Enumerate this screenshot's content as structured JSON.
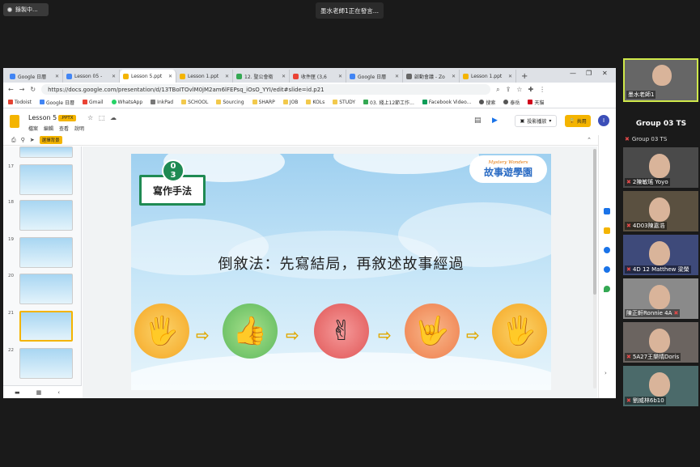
{
  "meeting": {
    "recording_label": "錄製中...",
    "speaker_banner": "墨水老師1正在發言..."
  },
  "browser": {
    "tabs": [
      {
        "label": "Google 日曆",
        "color": "#4285f4"
      },
      {
        "label": "Lesson 05 - ",
        "color": "#4285f4"
      },
      {
        "label": "Lesson 5.ppt",
        "color": "#f4b400",
        "active": true
      },
      {
        "label": "Lesson 1.ppt",
        "color": "#f4b400"
      },
      {
        "label": "12. 聖公會衛",
        "color": "#34a853"
      },
      {
        "label": "收件匣 (3,6",
        "color": "#ea4335"
      },
      {
        "label": "Google 日曆",
        "color": "#4285f4"
      },
      {
        "label": "啟動會議 - Zo",
        "color": "#666666"
      },
      {
        "label": "Lesson 1.ppt",
        "color": "#f4b400"
      }
    ],
    "new_tab": "+",
    "url": "https://docs.google.com/presentation/d/13TBoITOvlM0jM2am6lFEPsq_iOsO_YYI/edit#slide=id.p21",
    "bookmarks": [
      "Todoist",
      "Google 日曆",
      "Gmail",
      "WhatsApp",
      "InkPad",
      "SCHOOL",
      "Sourcing",
      "SHARP",
      "JOB",
      "KOLs",
      "STUDY",
      "03. 綫上12節工作...",
      "Facebook Video...",
      "搜索",
      "泰岳",
      "天貓"
    ]
  },
  "slides_app": {
    "doc_title": "Lesson 5",
    "file_badge": ".PPTX",
    "menu": [
      "檔案",
      "編輯",
      "查看",
      "說明"
    ],
    "slideshow_label": "投影播放",
    "share_label": "共用",
    "user_initial": "I",
    "background_option": "選擇背景",
    "thumb_numbers": [
      "17",
      "18",
      "19",
      "20",
      "21",
      "22"
    ]
  },
  "slide": {
    "section_number_top": "0",
    "section_number_bottom": "3",
    "section_title": "寫作手法",
    "logo_top": "Mystery Wonders",
    "logo_main": "故事遊學園",
    "heading": "倒敘法：先寫結局，再敘述故事經過",
    "hand_gestures": [
      "🖐",
      "👍",
      "✌",
      "🤟",
      "🖐"
    ]
  },
  "participants": {
    "host": "墨水老師1",
    "group_title": "Group 03 TS",
    "group_sub": "Group 03 TS",
    "list": [
      "2陳敏瑤 Yoyo",
      "4D03陳嘉浩",
      "4D 12 Matthew 梁榮",
      "陳正軒Ronnie 4A",
      "5A27王樂晴Doris",
      "劉威林6b10"
    ]
  }
}
